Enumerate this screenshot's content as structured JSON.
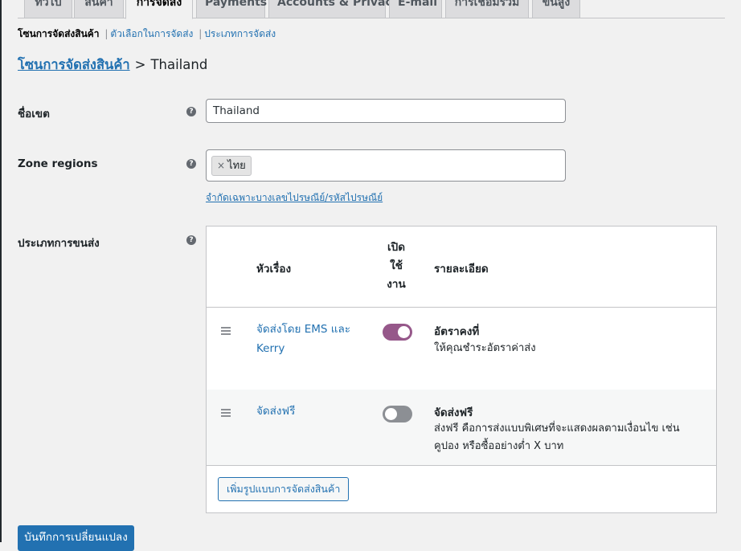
{
  "tabs": [
    {
      "label": "ทั่วไป"
    },
    {
      "label": "สินค้า"
    },
    {
      "label": "การจัดส่ง"
    },
    {
      "label": "Payments"
    },
    {
      "label": "Accounts & Privacy"
    },
    {
      "label": "E-mail"
    },
    {
      "label": "การเชื่อมรวม"
    },
    {
      "label": "ขั้นสูง"
    }
  ],
  "active_tab": "การจัดส่ง",
  "subnav": {
    "current": "โซนการจัดส่งสินค้า",
    "links": [
      "ตัวเลือกในการจัดส่ง",
      "ประเภทการจัดส่ง"
    ],
    "separator": "|"
  },
  "breadcrumb": {
    "link": "โซนการจัดส่งสินค้า",
    "separator": ">",
    "current": "Thailand"
  },
  "zone_name": {
    "label": "ชื่อเขต",
    "value": "Thailand"
  },
  "zone_regions": {
    "label": "Zone regions",
    "chips": [
      {
        "remove": "×",
        "label": "ไทย"
      }
    ],
    "limit_link": "จำกัดเฉพาะบางเลขไปรษณีย์/รหัสไปรษณีย์"
  },
  "help_glyph": "?",
  "shipping_methods": {
    "label": "ประเภทการขนส่ง",
    "columns": {
      "title": "หัวเรื่อง",
      "enabled_lines": [
        "เปิด",
        "ใช้",
        "งาน"
      ],
      "description": "รายละเอียด"
    },
    "rows": [
      {
        "title_lines": [
          "จัดส่งโดย EMS และ",
          "Kerry"
        ],
        "enabled": true,
        "desc_title": "อัตราคงที่",
        "desc_lines": [
          "ให้คุณชำระอัตราค่าส่ง"
        ]
      },
      {
        "title_lines": [
          "จัดส่งฟรี"
        ],
        "enabled": false,
        "desc_title": "จัดส่งฟรี",
        "desc_lines": [
          "ส่งฟรี คือการส่งแบบพิเศษที่จะแสดงผลตามเงื่อนไข เช่น",
          "คูปอง หรือซื้ออย่างต่ำ X บาท"
        ]
      }
    ],
    "add_button": "เพิ่มรูปแบบการจัดส่งสินค้า"
  },
  "save_button": "บันทึกการเปลี่ยนแปลง",
  "colors": {
    "link": "#2271b1",
    "toggle_on": "#96588a",
    "toggle_off": "#8c8f94",
    "save_button_bg": "#2271b1",
    "page_bg": "#f1f1f1"
  }
}
